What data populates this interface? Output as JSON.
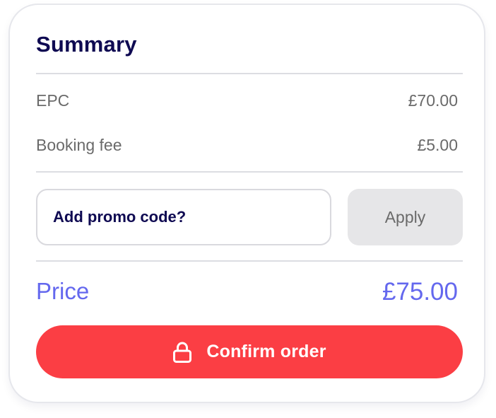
{
  "summary": {
    "title": "Summary",
    "items": [
      {
        "label": "EPC",
        "value": "£70.00"
      },
      {
        "label": "Booking fee",
        "value": "£5.00"
      }
    ]
  },
  "promo": {
    "placeholder": "Add promo code?",
    "value": "",
    "apply_label": "Apply"
  },
  "total": {
    "label": "Price",
    "value": "£75.00"
  },
  "confirm": {
    "label": "Confirm order",
    "icon": "lock-icon"
  },
  "colors": {
    "title": "#0f0a52",
    "accent": "#6468ee",
    "confirm_bg": "#fb3e44",
    "muted_text": "#6a6a6a"
  }
}
